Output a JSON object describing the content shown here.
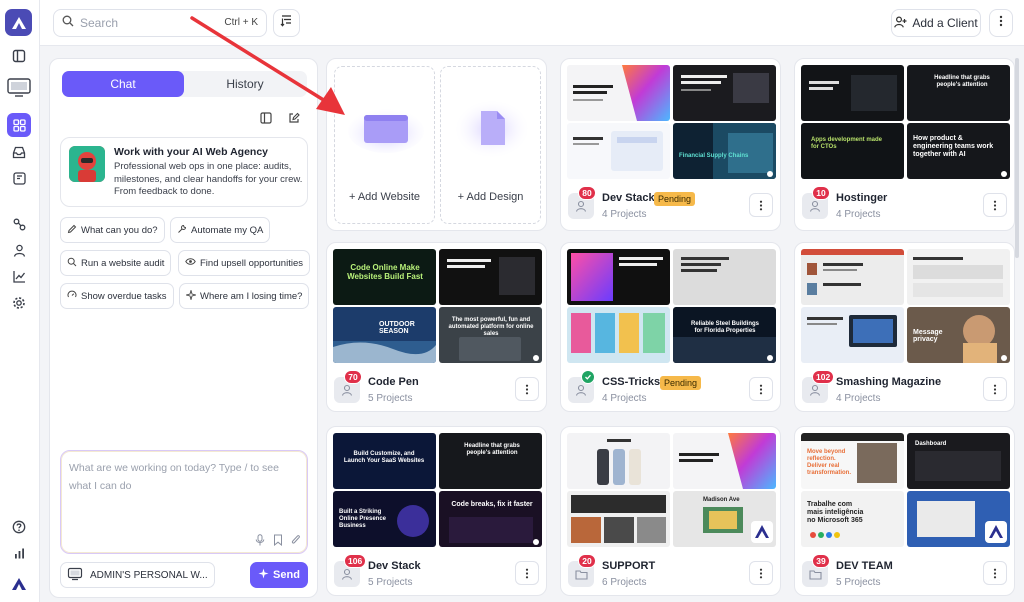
{
  "topbar": {
    "search_placeholder": "Search",
    "search_shortcut": "Ctrl + K",
    "add_client_label": "Add a Client"
  },
  "chat": {
    "tab_chat": "Chat",
    "tab_history": "History",
    "agency_title": "Work with your AI Web Agency",
    "agency_desc": "Professional web ops in one place: audits, milestones, and clear handoffs for your crew. From feedback to done.",
    "suggestions": [
      "What can you do?",
      "Automate my QA",
      "Run a website audit",
      "Find upsell opportunities",
      "Show overdue tasks",
      "Where am I losing time?"
    ],
    "composer_placeholder": "What are we working on today? Type / to see what I can do",
    "workspace_label": "ADMIN'S PERSONAL W...",
    "send_label": "Send"
  },
  "add": {
    "add_website": "+ Add Website",
    "add_design": "+ Add Design"
  },
  "clients": [
    {
      "name": "Dev Stack",
      "badge": "80",
      "projects": "4 Projects",
      "status": "Pending"
    },
    {
      "name": "Hostinger",
      "badge": "10",
      "projects": "4 Projects",
      "status": ""
    },
    {
      "name": "Code Pen",
      "badge": "70",
      "projects": "5 Projects",
      "status": ""
    },
    {
      "name": "CSS-Tricks",
      "badge": "",
      "projects": "4 Projects",
      "status": "Pending"
    },
    {
      "name": "Smashing Magazine",
      "badge": "102",
      "projects": "4 Projects",
      "status": ""
    },
    {
      "name": "Dev Stack",
      "badge": "106",
      "projects": "5 Projects",
      "status": ""
    },
    {
      "name": "SUPPORT",
      "badge": "20",
      "projects": "6 Projects",
      "status": ""
    },
    {
      "name": "DEV TEAM",
      "badge": "39",
      "projects": "5 Projects",
      "status": ""
    }
  ],
  "thumb_text": {
    "dev_stack": [
      "Your debriefed strategy unpacks"
    ],
    "hostinger_a": "Headline that grabs people's attention",
    "hostinger_b": "How product & engineering teams work together with AI",
    "hostinger_c": "Apps development made for CTOs",
    "dev_stack_fin": "Financial Supply Chains",
    "codepen_a": "Code Online Make Websites Build Fast",
    "codepen_b": "OUTDOOR SEASON",
    "codepen_c": "The most powerful, fun and automated platform for online sales",
    "css_a": "Reliable Steel Buildings for Florida Properties",
    "smash_a": "Message privacy",
    "devstack2_a": "Build Customize, and Launch Your SaaS Websites",
    "devstack2_b": "Headline that grabs people's attention",
    "devstack2_c": "Built a Striking Online Presence Business",
    "devstack2_d": "Code breaks, fix it faster",
    "support_a": "Madison Ave",
    "devteam_a": "Move beyond reflection. Deliver real transformation.",
    "devteam_b": "Trabalhe com mais inteligência no Microsoft 365",
    "devteam_c": "Dashboard"
  },
  "colors": {
    "accent": "#6a5af9",
    "badge": "#e0304a",
    "pending": "#f6b94a",
    "annotation_arrow": "#e8343a"
  }
}
